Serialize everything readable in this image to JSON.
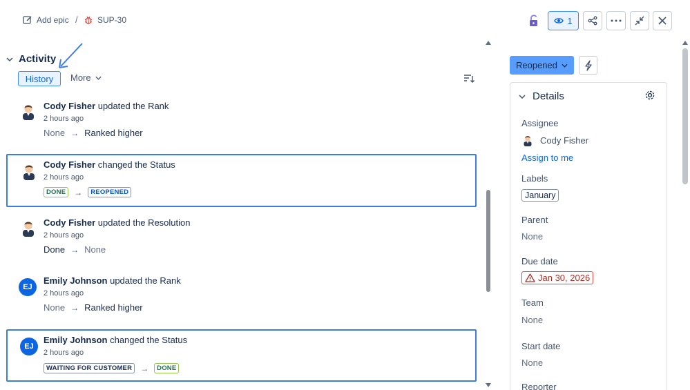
{
  "breadcrumb": {
    "add_epic": "Add epic",
    "separator": "/",
    "issue_key": "SUP-30"
  },
  "toolbar": {
    "watch_count": "1"
  },
  "activity": {
    "title": "Activity",
    "tabs": {
      "history": "History",
      "more": "More"
    },
    "entries": [
      {
        "author": "Cody Fisher",
        "action": "updated the",
        "field": "Rank",
        "time": "2 hours ago",
        "from": "None",
        "to": "Ranked higher",
        "avatar": "person-avatar"
      },
      {
        "author": "Cody Fisher",
        "action": "changed the",
        "field": "Status",
        "time": "2 hours ago",
        "from": "DONE",
        "to": "REOPENED",
        "avatar": "person-avatar"
      },
      {
        "author": "Cody Fisher",
        "action": "updated the",
        "field": "Resolution",
        "time": "2 hours ago",
        "from": "Done",
        "to": "None",
        "avatar": "person-avatar"
      },
      {
        "author": "Emily Johnson",
        "action": "updated the",
        "field": "Rank",
        "time": "2 hours ago",
        "from": "None",
        "to": "Ranked higher",
        "avatar": "EJ"
      },
      {
        "author": "Emily Johnson",
        "action": "changed the",
        "field": "Status",
        "time": "2 hours ago",
        "from": "WAITING FOR CUSTOMER",
        "to": "DONE",
        "avatar": "EJ"
      }
    ]
  },
  "status_button": {
    "label": "Reopened"
  },
  "details": {
    "title": "Details",
    "assignee_label": "Assignee",
    "assignee_name": "Cody Fisher",
    "assign_to_me": "Assign to me",
    "labels_label": "Labels",
    "labels_value": "January",
    "parent_label": "Parent",
    "parent_value": "None",
    "due_label": "Due date",
    "due_value": "Jan 30, 2026",
    "team_label": "Team",
    "team_value": "None",
    "start_label": "Start date",
    "start_value": "None",
    "reporter_label": "Reporter"
  },
  "colors": {
    "accent": "#0c66e4",
    "highlight_border": "#3c7ee0",
    "status_button": "#579dff",
    "overdue": "#e2483d"
  }
}
